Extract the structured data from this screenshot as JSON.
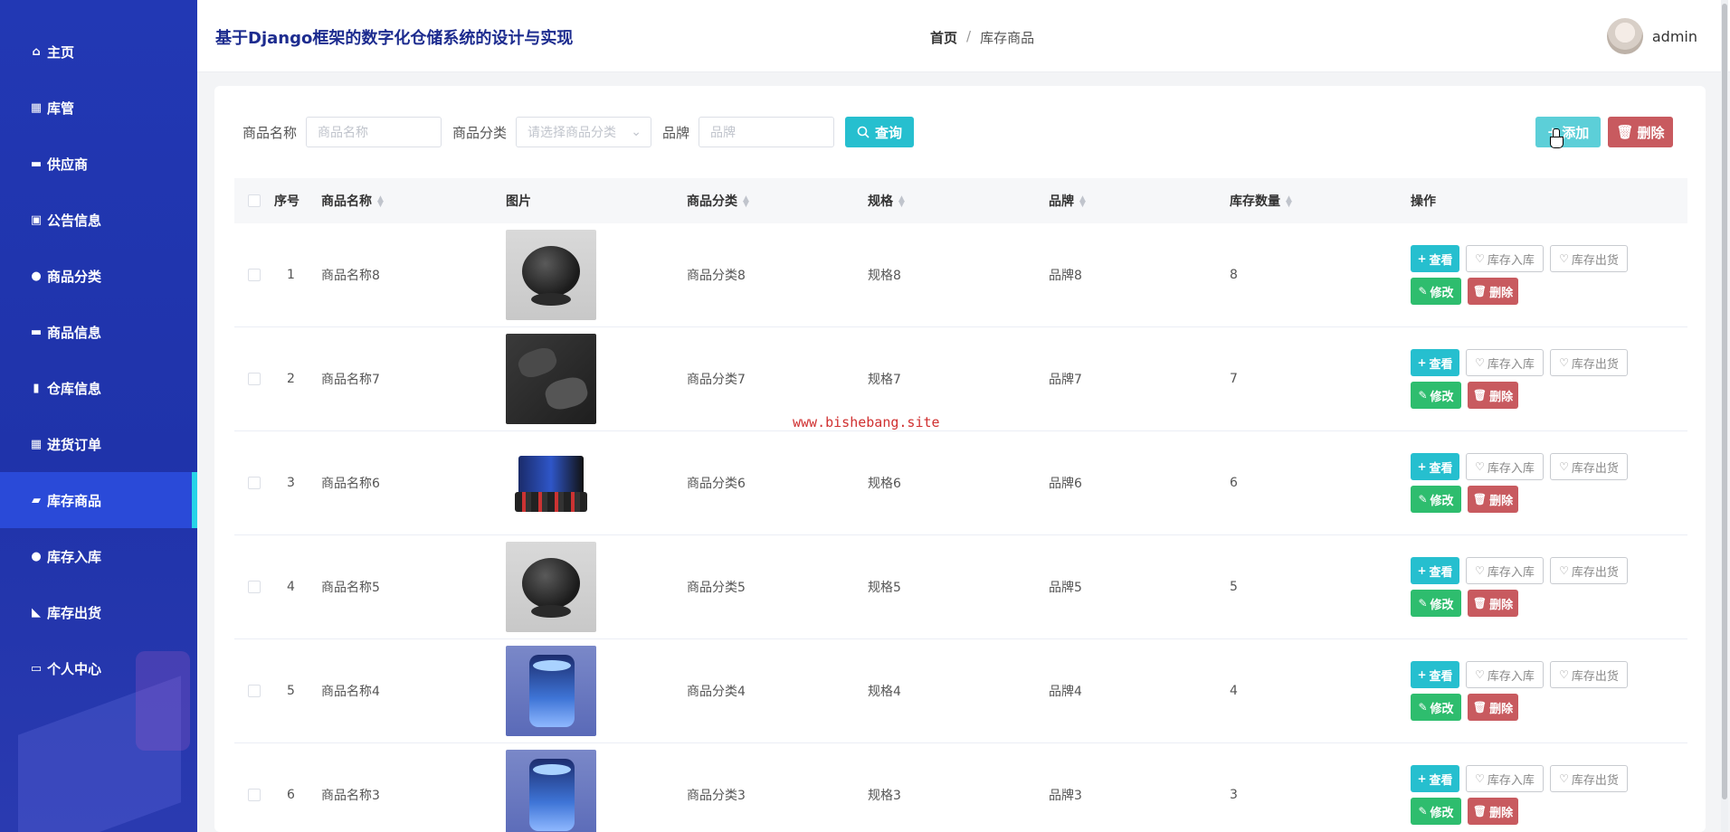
{
  "app": {
    "title": "基于Django框架的数字化仓储系统的设计与实现",
    "watermark": "www.bishebang.site"
  },
  "breadcrumb": {
    "home": "首页",
    "separator": "/",
    "current": "库存商品"
  },
  "user": {
    "name": "admin"
  },
  "sidebar": {
    "items": [
      {
        "label": "主页",
        "icon": "home-icon",
        "glyph": "⌂"
      },
      {
        "label": "库管",
        "icon": "grid-icon",
        "glyph": "▦"
      },
      {
        "label": "供应商",
        "icon": "monitor-icon",
        "glyph": "▬"
      },
      {
        "label": "公告信息",
        "icon": "clipboard-icon",
        "glyph": "▣"
      },
      {
        "label": "商品分类",
        "icon": "user-icon",
        "glyph": "●"
      },
      {
        "label": "商品信息",
        "icon": "ticket-icon",
        "glyph": "▬"
      },
      {
        "label": "仓库信息",
        "icon": "building-icon",
        "glyph": "▮"
      },
      {
        "label": "进货订单",
        "icon": "grid-icon",
        "glyph": "▦"
      },
      {
        "label": "库存商品",
        "icon": "comment-icon",
        "glyph": "▰",
        "active": true
      },
      {
        "label": "库存入库",
        "icon": "bulb-icon",
        "glyph": "●"
      },
      {
        "label": "库存出货",
        "icon": "truck-icon",
        "glyph": "◣"
      },
      {
        "label": "个人中心",
        "icon": "card-icon",
        "glyph": "▭"
      }
    ]
  },
  "search": {
    "name_label": "商品名称",
    "name_placeholder": "商品名称",
    "category_label": "商品分类",
    "category_placeholder": "请选择商品分类",
    "brand_label": "品牌",
    "brand_placeholder": "品牌",
    "query_label": "查询"
  },
  "toolbar": {
    "add_label": "添加",
    "delete_label": "删除"
  },
  "table": {
    "headers": [
      "序号",
      "商品名称",
      "图片",
      "商品分类",
      "规格",
      "品牌",
      "库存数量",
      "操作"
    ],
    "row_actions": {
      "view": "查看",
      "stock_in": "库存入库",
      "stock_out": "库存出货",
      "edit": "修改",
      "delete": "删除"
    },
    "rows": [
      {
        "index": "1",
        "name": "商品名称8",
        "image": "speaker",
        "category": "商品分类8",
        "spec": "规格8",
        "brand": "品牌8",
        "stock": "8"
      },
      {
        "index": "2",
        "name": "商品名称7",
        "image": "earbuds",
        "category": "商品分类7",
        "spec": "规格7",
        "brand": "品牌7",
        "stock": "7"
      },
      {
        "index": "3",
        "name": "商品名称6",
        "image": "bundle",
        "category": "商品分类6",
        "spec": "规格6",
        "brand": "品牌6",
        "stock": "6"
      },
      {
        "index": "4",
        "name": "商品名称5",
        "image": "speaker",
        "category": "商品分类5",
        "spec": "规格5",
        "brand": "品牌5",
        "stock": "5"
      },
      {
        "index": "5",
        "name": "商品名称4",
        "image": "purifier",
        "category": "商品分类4",
        "spec": "规格4",
        "brand": "品牌4",
        "stock": "4"
      },
      {
        "index": "6",
        "name": "商品名称3",
        "image": "purifier",
        "category": "商品分类3",
        "spec": "规格3",
        "brand": "品牌3",
        "stock": "3"
      }
    ]
  },
  "colors": {
    "sidebar": "#2238b4",
    "active_item": "#2a4ad8",
    "active_marker": "#27d3e8",
    "primary": "#26bfcf",
    "success": "#2ebd6e",
    "danger": "#c85a5f",
    "title": "#1d2c8f"
  }
}
